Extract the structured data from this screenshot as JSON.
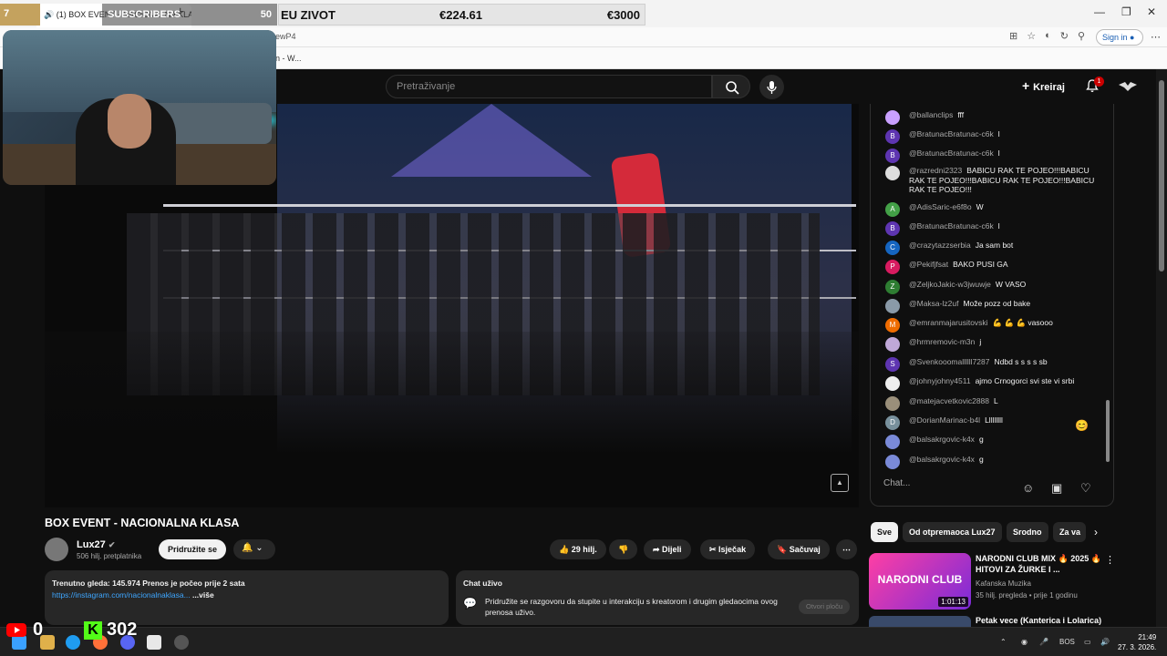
{
  "browser": {
    "tab_title": "(1) BOX EVENT - NACIONALNA KLASA",
    "url_fragment": "ewP4",
    "fav_fragment": "n - W...",
    "signin_label": "Sign in"
  },
  "overlay": {
    "goal_left": "7",
    "subscribers_label": "SUBSCRIBERS",
    "subscribers_count": "50",
    "sponsor_name": "EU ZIVOT",
    "sponsor_value": "€224.61",
    "sponsor_goal": "€3000",
    "youtube_count": "0",
    "kick_count": "302",
    "kick_letter": "K"
  },
  "header": {
    "search_placeholder": "Pretraživanje",
    "create_label": "Kreiraj",
    "notifications_count": "1"
  },
  "video": {
    "title": "BOX EVENT - NACIONALNA KLASA",
    "channel_name": "Lux27",
    "channel_subs": "506 hilj. pretplatnika",
    "join_label": "Pridružite se",
    "likes": "29 hilj.",
    "share_label": "Dijeli",
    "clip_label": "Isječak",
    "save_label": "Sačuvaj",
    "desc_line1": "Trenutno gleda: 145.974  Prenos je počeo prije 2 sata",
    "desc_link": "https://instagram.com/nacionalnaklasa...",
    "desc_more": "...više",
    "livechat_title": "Chat uživo",
    "livechat_text": "Pridružite se razgovoru da stupite u interakciju s kreatorom i drugim gledaocima ovog prenosa uživo.",
    "livechat_button": "Otvori ploču"
  },
  "chat": {
    "input_placeholder": "Chat...",
    "messages": [
      {
        "initial": "",
        "color": "#c9a0ff",
        "author": "@ballanclips",
        "text": "fff"
      },
      {
        "initial": "B",
        "color": "#5e35b1",
        "author": "@BratunacBratunac-c6k",
        "text": "l"
      },
      {
        "initial": "B",
        "color": "#5e35b1",
        "author": "@BratunacBratunac-c6k",
        "text": "l"
      },
      {
        "initial": "",
        "color": "#dddddd",
        "author": "@razredni2323",
        "text": "BABICU RAK TE POJEO!!!BABICU RAK TE POJEO!!!BABICU RAK TE POJEO!!!BABICU RAK TE POJEO!!!"
      },
      {
        "initial": "A",
        "color": "#43a047",
        "author": "@AdisSaric-e6f8o",
        "text": "W"
      },
      {
        "initial": "B",
        "color": "#5e35b1",
        "author": "@BratunacBratunac-c6k",
        "text": "l"
      },
      {
        "initial": "C",
        "color": "#1565c0",
        "author": "@crazytazzserbia",
        "text": "Ja sam bot"
      },
      {
        "initial": "P",
        "color": "#d81b60",
        "author": "@Pekifjfsat",
        "text": "BAKO PUSI GA"
      },
      {
        "initial": "Z",
        "color": "#2e7d32",
        "author": "@ZeljkoJakic-w3jwuwje",
        "text": "W VASO"
      },
      {
        "initial": "",
        "color": "#8a9aa8",
        "author": "@Maksa-lz2uf",
        "text": "Može pozz od bake"
      },
      {
        "initial": "M",
        "color": "#ef6c00",
        "author": "@emranmajarusitovski",
        "text": "💪 💪 💪 vasooo"
      },
      {
        "initial": "",
        "color": "#c0a8d8",
        "author": "@hrmremovic-m3n",
        "text": "j"
      },
      {
        "initial": "S",
        "color": "#5e35b1",
        "author": "@Svenkooomallllll7287",
        "text": "Ndbd s s s s sb"
      },
      {
        "initial": "",
        "color": "#eeeeee",
        "author": "@johnyjohny4511",
        "text": "ajmo Crnogorci svi ste vi srbi"
      },
      {
        "initial": "",
        "color": "#9a8f7a",
        "author": "@matejacvetkovic2888",
        "text": "L"
      },
      {
        "initial": "D",
        "color": "#78909c",
        "author": "@DorianMarinac-b4l",
        "text": "Lllllllll"
      },
      {
        "initial": "",
        "color": "#7a8ad8",
        "author": "@balsakrgovic-k4x",
        "text": "g"
      },
      {
        "initial": "",
        "color": "#7a8ad8",
        "author": "@balsakrgovic-k4x",
        "text": "g"
      }
    ]
  },
  "chips": [
    "Sve",
    "Od otpremaoca Lux27",
    "Srodno",
    "Za va"
  ],
  "recommended": [
    {
      "title": "NARODNI CLUB MIX 🔥 2025 🔥 HITOVI ZA ŽURKE I ...",
      "channel": "Kafanska Muzika",
      "meta": "35 hilj. pregleda • prije 1 godinu",
      "thumb_text": "NARODNI CLUB",
      "duration": "1:01:13"
    },
    {
      "title": "Petak vece (Kanterica i Lolarica)"
    }
  ],
  "taskbar": {
    "lang": "BOS",
    "time": "21:49",
    "date": "27. 3. 2026."
  }
}
